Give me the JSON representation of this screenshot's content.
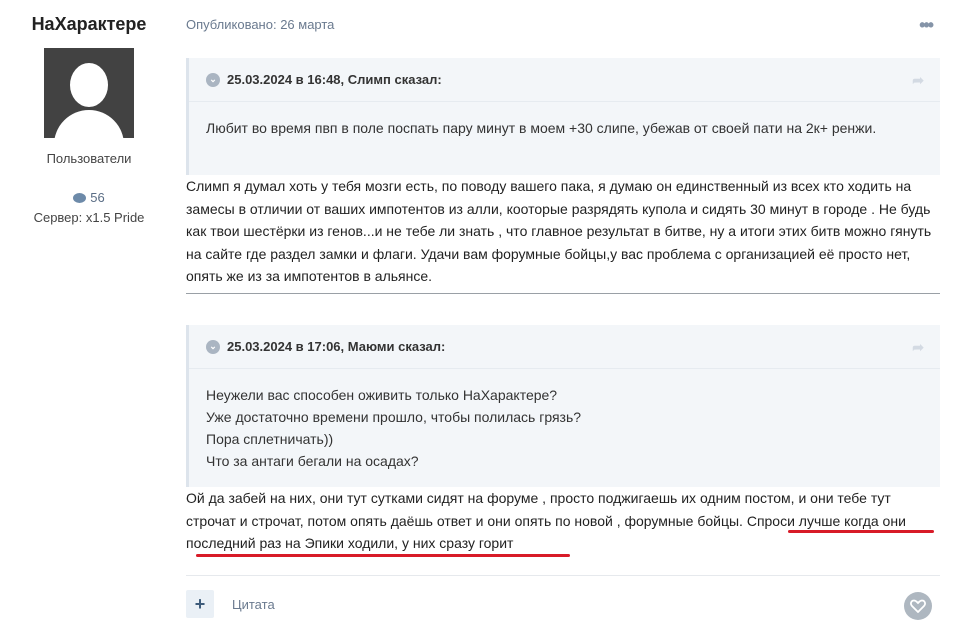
{
  "author": {
    "name": "НаХарактере",
    "group": "Пользователи",
    "post_count": "56",
    "server": "Сервер: x1.5 Pride"
  },
  "post": {
    "published": "Опубликовано: 26 марта",
    "quote1": {
      "header": "25.03.2024 в 16:48, Слимп сказал:",
      "body": "Любит во время пвп в поле поспать пару минут в моем +30 слипе, убежав от своей пати на 2к+ ренжи."
    },
    "reply1": "Слимп я думал хоть у тебя мозги есть, по поводу вашего пака, я думаю он единственный из всех кто ходить на замесы в отличии от ваших импотентов из алли, кооторые разрядять купола и сидять 30 минут в городе . Не будь как твои шестёрки из генов...и не тебе ли знать , что главное результат в битве, ну а итоги этих битв можно гянуть на сайте где раздел замки и флаги. Удачи вам форумные бойцы,у вас проблема с организацией её просто нет, опять же из за импотентов в альянсе.",
    "quote2": {
      "header": "25.03.2024 в 17:06, Маюми сказал:",
      "lines": [
        "Неужели вас способен оживить только НаХарактере?",
        "Уже достаточно времени прошло, чтобы полилась грязь?",
        "Пора сплетничать))",
        "Что за антаги бегали на осадах?"
      ]
    },
    "reply2": "Ой да забей на них, они тут сутками сидят на форуме , просто поджигаешь их одним постом, и они тебе тут строчат  и строчат, потом опять даёшь ответ и они опять по новой , форумные бойцы. Спроси лучше когда они последний раз на Эпики ходили, у них сразу горит",
    "footer": {
      "plus_label": "+",
      "quote_label": "Цитата"
    }
  },
  "colors": {
    "accent": "#3d5b7a",
    "underline": "#d81b28",
    "quote_bg": "#f3f6f9"
  }
}
